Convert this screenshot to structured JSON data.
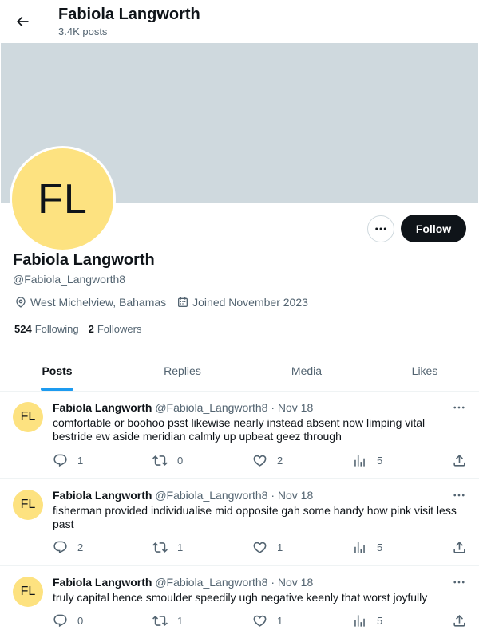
{
  "header": {
    "name": "Fabiola Langworth",
    "posts_count": "3.4K posts"
  },
  "profile": {
    "initials": "FL",
    "name": "Fabiola Langworth",
    "handle": "@Fabiola_Langworth8",
    "location": "West Michelview, Bahamas",
    "joined": "Joined November 2023",
    "following_count": "524",
    "following_label": "Following",
    "followers_count": "2",
    "followers_label": "Followers",
    "follow_label": "Follow",
    "avatar_color": "#fde280",
    "banner_color": "#cfd9de"
  },
  "tabs": [
    {
      "label": "Posts",
      "active": true
    },
    {
      "label": "Replies",
      "active": false
    },
    {
      "label": "Media",
      "active": false
    },
    {
      "label": "Likes",
      "active": false
    }
  ],
  "posts": [
    {
      "initials": "FL",
      "name": "Fabiola Langworth",
      "handle": "@Fabiola_Langworth8",
      "dot": "·",
      "date": "Nov 18",
      "text": "comfortable or boohoo psst likewise nearly instead absent now limping vital bestride ew aside meridian calmly up upbeat geez through",
      "replies": "1",
      "reposts": "0",
      "likes": "2",
      "views": "5"
    },
    {
      "initials": "FL",
      "name": "Fabiola Langworth",
      "handle": "@Fabiola_Langworth8",
      "dot": "·",
      "date": "Nov 18",
      "text": "fisherman provided individualise mid opposite gah some handy how pink visit less past",
      "replies": "2",
      "reposts": "1",
      "likes": "1",
      "views": "5"
    },
    {
      "initials": "FL",
      "name": "Fabiola Langworth",
      "handle": "@Fabiola_Langworth8",
      "dot": "·",
      "date": "Nov 18",
      "text": "truly capital hence smoulder speedily ugh negative keenly that worst joyfully",
      "replies": "0",
      "reposts": "1",
      "likes": "1",
      "views": "5"
    }
  ],
  "colors": {
    "accent": "#1d9bf0",
    "text_primary": "#0f1419",
    "text_secondary": "#536471"
  }
}
